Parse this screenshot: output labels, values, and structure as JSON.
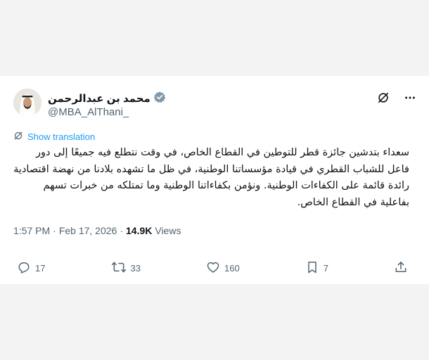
{
  "tweet": {
    "author_name": "محمد بن عبدالرحمن",
    "handle": "@MBA_AlThani_",
    "translate_label": "Show translation",
    "text": "سعداء بتدشين جائزة قطر للتوطين في القطاع الخاص، في وقت نتطلع فيه جميعًا إلى دور فاعل للشباب القطري في قيادة مؤسساتنا الوطنية، في ظل ما تشهده بلادنا من نهضة اقتصادية رائدة قائمة على الكفاءات الوطنية. ونؤمن بكفاءاتنا الوطنية وما تمتلكه من خبرات تسهم بفاعلية في القطاع الخاص.",
    "time": "1:57 PM",
    "separator": "·",
    "date": "Feb 17, 2026",
    "views_count": "14.9K",
    "views_label": "Views"
  },
  "actions": {
    "replies": "17",
    "reposts": "33",
    "likes": "160",
    "bookmarks": "7"
  },
  "colors": {
    "accent": "#1d9bf0",
    "muted": "#536471",
    "text": "#0f1419"
  },
  "icons": [
    "verified-badge-icon",
    "grok-icon",
    "more-icon",
    "translate-icon",
    "reply-icon",
    "repost-icon",
    "like-icon",
    "bookmark-icon",
    "share-icon"
  ]
}
